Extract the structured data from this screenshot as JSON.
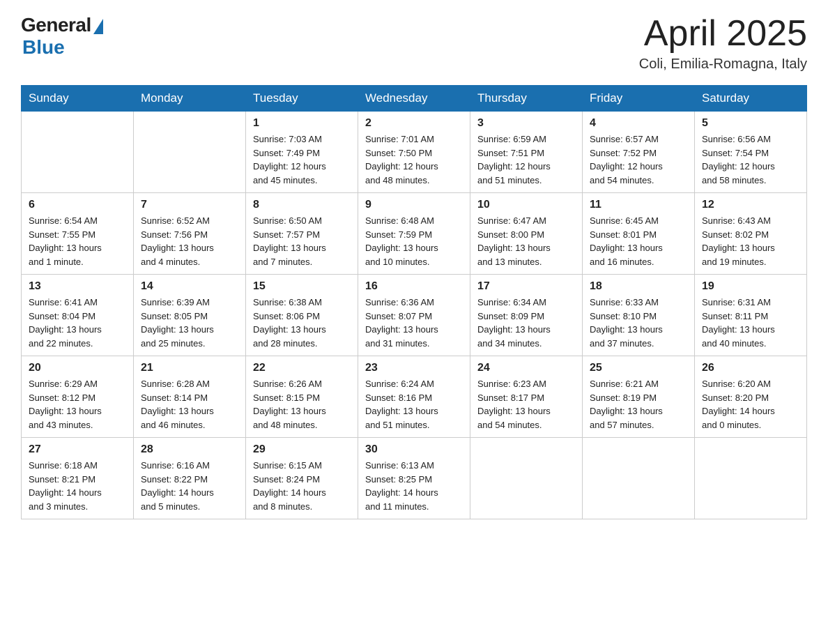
{
  "header": {
    "logo_general": "General",
    "logo_blue": "Blue",
    "month_title": "April 2025",
    "location": "Coli, Emilia-Romagna, Italy"
  },
  "days_of_week": [
    "Sunday",
    "Monday",
    "Tuesday",
    "Wednesday",
    "Thursday",
    "Friday",
    "Saturday"
  ],
  "weeks": [
    [
      {
        "day": "",
        "info": ""
      },
      {
        "day": "",
        "info": ""
      },
      {
        "day": "1",
        "info": "Sunrise: 7:03 AM\nSunset: 7:49 PM\nDaylight: 12 hours\nand 45 minutes."
      },
      {
        "day": "2",
        "info": "Sunrise: 7:01 AM\nSunset: 7:50 PM\nDaylight: 12 hours\nand 48 minutes."
      },
      {
        "day": "3",
        "info": "Sunrise: 6:59 AM\nSunset: 7:51 PM\nDaylight: 12 hours\nand 51 minutes."
      },
      {
        "day": "4",
        "info": "Sunrise: 6:57 AM\nSunset: 7:52 PM\nDaylight: 12 hours\nand 54 minutes."
      },
      {
        "day": "5",
        "info": "Sunrise: 6:56 AM\nSunset: 7:54 PM\nDaylight: 12 hours\nand 58 minutes."
      }
    ],
    [
      {
        "day": "6",
        "info": "Sunrise: 6:54 AM\nSunset: 7:55 PM\nDaylight: 13 hours\nand 1 minute."
      },
      {
        "day": "7",
        "info": "Sunrise: 6:52 AM\nSunset: 7:56 PM\nDaylight: 13 hours\nand 4 minutes."
      },
      {
        "day": "8",
        "info": "Sunrise: 6:50 AM\nSunset: 7:57 PM\nDaylight: 13 hours\nand 7 minutes."
      },
      {
        "day": "9",
        "info": "Sunrise: 6:48 AM\nSunset: 7:59 PM\nDaylight: 13 hours\nand 10 minutes."
      },
      {
        "day": "10",
        "info": "Sunrise: 6:47 AM\nSunset: 8:00 PM\nDaylight: 13 hours\nand 13 minutes."
      },
      {
        "day": "11",
        "info": "Sunrise: 6:45 AM\nSunset: 8:01 PM\nDaylight: 13 hours\nand 16 minutes."
      },
      {
        "day": "12",
        "info": "Sunrise: 6:43 AM\nSunset: 8:02 PM\nDaylight: 13 hours\nand 19 minutes."
      }
    ],
    [
      {
        "day": "13",
        "info": "Sunrise: 6:41 AM\nSunset: 8:04 PM\nDaylight: 13 hours\nand 22 minutes."
      },
      {
        "day": "14",
        "info": "Sunrise: 6:39 AM\nSunset: 8:05 PM\nDaylight: 13 hours\nand 25 minutes."
      },
      {
        "day": "15",
        "info": "Sunrise: 6:38 AM\nSunset: 8:06 PM\nDaylight: 13 hours\nand 28 minutes."
      },
      {
        "day": "16",
        "info": "Sunrise: 6:36 AM\nSunset: 8:07 PM\nDaylight: 13 hours\nand 31 minutes."
      },
      {
        "day": "17",
        "info": "Sunrise: 6:34 AM\nSunset: 8:09 PM\nDaylight: 13 hours\nand 34 minutes."
      },
      {
        "day": "18",
        "info": "Sunrise: 6:33 AM\nSunset: 8:10 PM\nDaylight: 13 hours\nand 37 minutes."
      },
      {
        "day": "19",
        "info": "Sunrise: 6:31 AM\nSunset: 8:11 PM\nDaylight: 13 hours\nand 40 minutes."
      }
    ],
    [
      {
        "day": "20",
        "info": "Sunrise: 6:29 AM\nSunset: 8:12 PM\nDaylight: 13 hours\nand 43 minutes."
      },
      {
        "day": "21",
        "info": "Sunrise: 6:28 AM\nSunset: 8:14 PM\nDaylight: 13 hours\nand 46 minutes."
      },
      {
        "day": "22",
        "info": "Sunrise: 6:26 AM\nSunset: 8:15 PM\nDaylight: 13 hours\nand 48 minutes."
      },
      {
        "day": "23",
        "info": "Sunrise: 6:24 AM\nSunset: 8:16 PM\nDaylight: 13 hours\nand 51 minutes."
      },
      {
        "day": "24",
        "info": "Sunrise: 6:23 AM\nSunset: 8:17 PM\nDaylight: 13 hours\nand 54 minutes."
      },
      {
        "day": "25",
        "info": "Sunrise: 6:21 AM\nSunset: 8:19 PM\nDaylight: 13 hours\nand 57 minutes."
      },
      {
        "day": "26",
        "info": "Sunrise: 6:20 AM\nSunset: 8:20 PM\nDaylight: 14 hours\nand 0 minutes."
      }
    ],
    [
      {
        "day": "27",
        "info": "Sunrise: 6:18 AM\nSunset: 8:21 PM\nDaylight: 14 hours\nand 3 minutes."
      },
      {
        "day": "28",
        "info": "Sunrise: 6:16 AM\nSunset: 8:22 PM\nDaylight: 14 hours\nand 5 minutes."
      },
      {
        "day": "29",
        "info": "Sunrise: 6:15 AM\nSunset: 8:24 PM\nDaylight: 14 hours\nand 8 minutes."
      },
      {
        "day": "30",
        "info": "Sunrise: 6:13 AM\nSunset: 8:25 PM\nDaylight: 14 hours\nand 11 minutes."
      },
      {
        "day": "",
        "info": ""
      },
      {
        "day": "",
        "info": ""
      },
      {
        "day": "",
        "info": ""
      }
    ]
  ]
}
